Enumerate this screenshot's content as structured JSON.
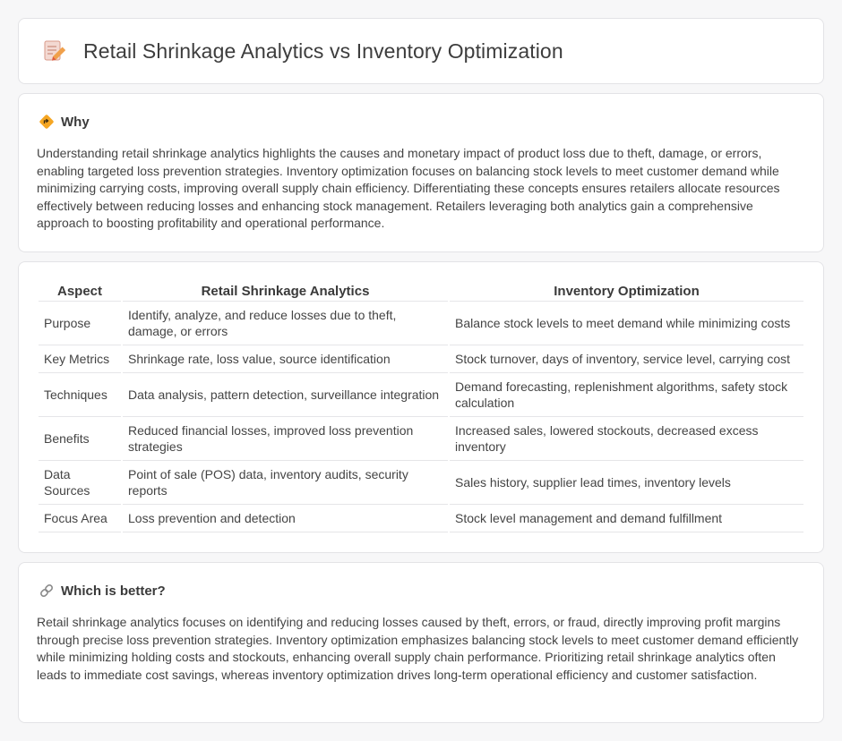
{
  "page": {
    "title": "Retail Shrinkage Analytics vs Inventory Optimization"
  },
  "why": {
    "heading": "Why",
    "text": "Understanding retail shrinkage analytics highlights the causes and monetary impact of product loss due to theft, damage, or errors, enabling targeted loss prevention strategies. Inventory optimization focuses on balancing stock levels to meet customer demand while minimizing carrying costs, improving overall supply chain efficiency. Differentiating these concepts ensures retailers allocate resources effectively between reducing losses and enhancing stock management. Retailers leveraging both analytics gain a comprehensive approach to boosting profitability and operational performance."
  },
  "table": {
    "headers": [
      "Aspect",
      "Retail Shrinkage Analytics",
      "Inventory Optimization"
    ],
    "rows": [
      [
        "Purpose",
        "Identify, analyze, and reduce losses due to theft, damage, or errors",
        "Balance stock levels to meet demand while minimizing costs"
      ],
      [
        "Key Metrics",
        "Shrinkage rate, loss value, source identification",
        "Stock turnover, days of inventory, service level, carrying cost"
      ],
      [
        "Techniques",
        "Data analysis, pattern detection, surveillance integration",
        "Demand forecasting, replenishment algorithms, safety stock calculation"
      ],
      [
        "Benefits",
        "Reduced financial losses, improved loss prevention strategies",
        "Increased sales, lowered stockouts, decreased excess inventory"
      ],
      [
        "Data Sources",
        "Point of sale (POS) data, inventory audits, security reports",
        "Sales history, supplier lead times, inventory levels"
      ],
      [
        "Focus Area",
        "Loss prevention and detection",
        "Stock level management and demand fulfillment"
      ]
    ]
  },
  "better": {
    "heading": "Which is better?",
    "text": "Retail shrinkage analytics focuses on identifying and reducing losses caused by theft, errors, or fraud, directly improving profit margins through precise loss prevention strategies. Inventory optimization emphasizes balancing stock levels to meet customer demand efficiently while minimizing holding costs and stockouts, enhancing overall supply chain performance. Prioritizing retail shrinkage analytics often leads to immediate cost savings, whereas inventory optimization drives long-term operational efficiency and customer satisfaction."
  },
  "icons": {
    "title": "memo-pencil-icon",
    "why": "diamond-direction-icon",
    "better": "link-icon"
  }
}
